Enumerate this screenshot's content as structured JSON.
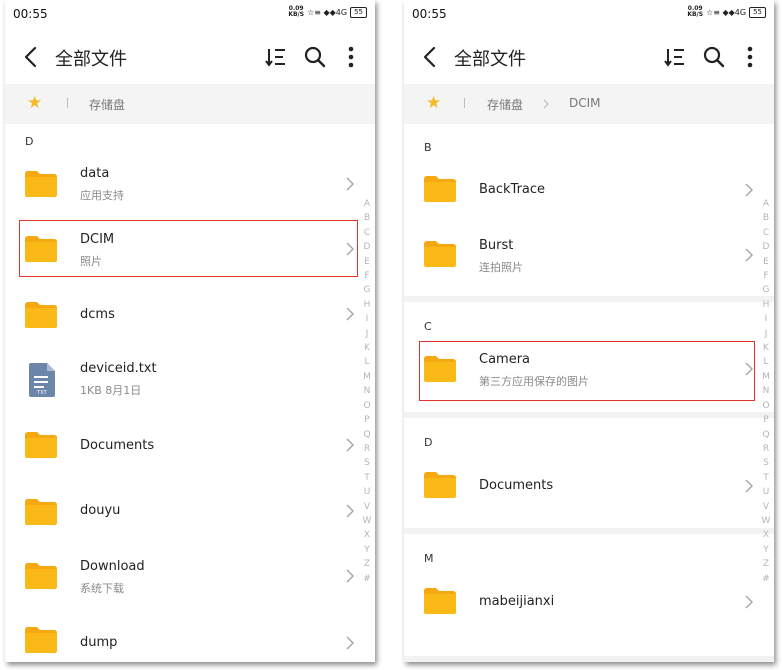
{
  "phones": [
    {
      "status": {
        "time": "00:55",
        "speed": "0.09\nKB/S",
        "signal": "☆≡ ◆◆4G",
        "battery": "55"
      },
      "header": {
        "title": "全部文件"
      },
      "breadcrumb": [
        "存储盘"
      ],
      "index_letters": [
        "A",
        "B",
        "C",
        "D",
        "E",
        "F",
        "G",
        "H",
        "I",
        "J",
        "K",
        "L",
        "M",
        "N",
        "O",
        "P",
        "Q",
        "R",
        "S",
        "T",
        "U",
        "V",
        "W",
        "X",
        "Y",
        "Z",
        "#"
      ],
      "sections": [
        {
          "letter": "D",
          "items": [
            {
              "name": "data",
              "sub": "应用支持",
              "type": "folder"
            },
            {
              "name": "DCIM",
              "sub": "照片",
              "type": "folder",
              "highlighted": true
            },
            {
              "name": "dcms",
              "sub": "",
              "type": "folder"
            },
            {
              "name": "deviceid.txt",
              "sub": "1KB  8月1日",
              "type": "txt"
            },
            {
              "name": "Documents",
              "sub": "",
              "type": "folder"
            },
            {
              "name": "douyu",
              "sub": "",
              "type": "folder"
            },
            {
              "name": "Download",
              "sub": "系统下载",
              "type": "folder"
            },
            {
              "name": "dump",
              "sub": "",
              "type": "folder"
            }
          ]
        }
      ]
    },
    {
      "status": {
        "time": "00:55",
        "speed": "0.09\nKB/S",
        "signal": "☆≡ ◆◆4G",
        "battery": "55"
      },
      "header": {
        "title": "全部文件"
      },
      "breadcrumb": [
        "存储盘",
        "DCIM"
      ],
      "index_letters": [
        "A",
        "B",
        "C",
        "D",
        "E",
        "F",
        "G",
        "H",
        "I",
        "J",
        "K",
        "L",
        "M",
        "N",
        "O",
        "P",
        "Q",
        "R",
        "S",
        "T",
        "U",
        "V",
        "W",
        "X",
        "Y",
        "Z",
        "#"
      ],
      "sections": [
        {
          "letter": "B",
          "items": [
            {
              "name": "BackTrace",
              "sub": "",
              "type": "folder"
            },
            {
              "name": "Burst",
              "sub": "连拍照片",
              "type": "folder"
            }
          ]
        },
        {
          "letter": "C",
          "items": [
            {
              "name": "Camera",
              "sub": "第三方应用保存的图片",
              "type": "folder",
              "highlighted": true
            }
          ]
        },
        {
          "letter": "D",
          "items": [
            {
              "name": "Documents",
              "sub": "",
              "type": "folder"
            }
          ]
        },
        {
          "letter": "M",
          "items": [
            {
              "name": "mabeijianxi",
              "sub": "",
              "type": "folder"
            }
          ]
        }
      ]
    }
  ],
  "colors": {
    "folder": "#fbb917",
    "folder_dark": "#f5a80f",
    "highlight": "#e0352f",
    "star": "#f7b924"
  }
}
